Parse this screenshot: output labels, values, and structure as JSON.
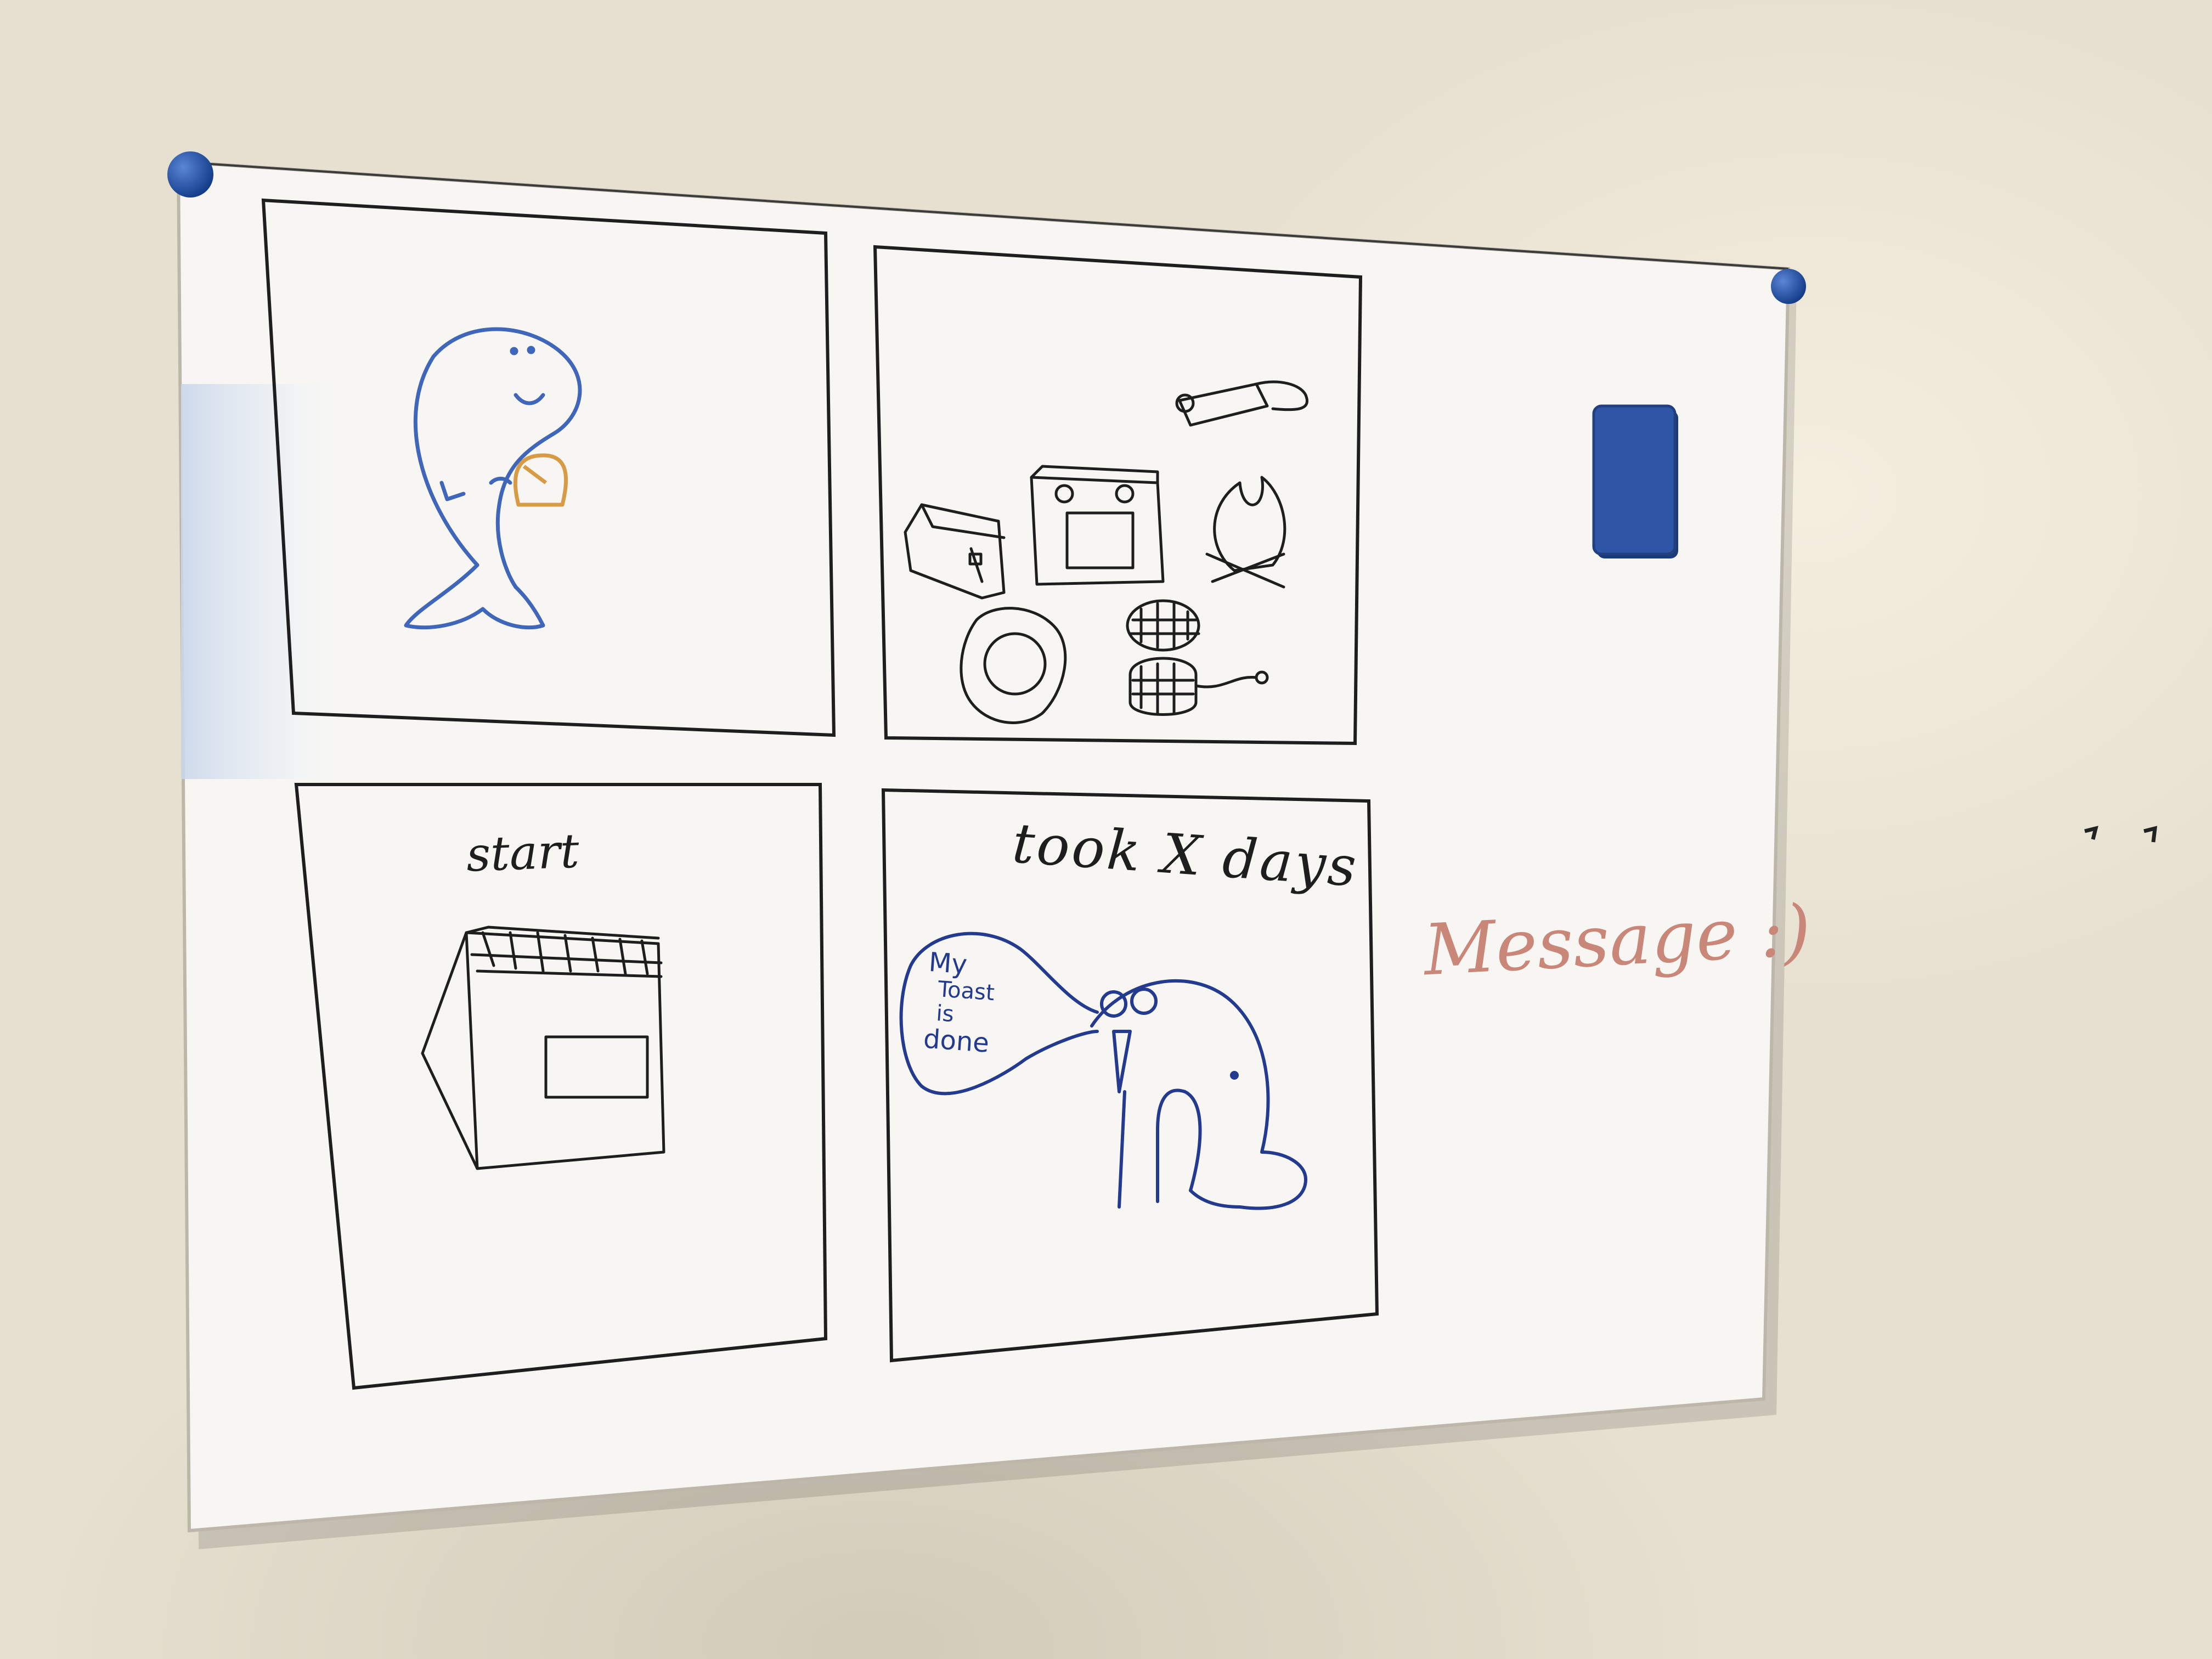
{
  "scene": {
    "wall_color": "#e6e0d0",
    "board_color": "#f7f6f2",
    "magnet_color": "#1f4fa8",
    "eraser_color": "#2e55a6",
    "blue_marker": "#3f66b8",
    "black_marker": "#1e1e1e",
    "red_marker": "#c9877a",
    "orange_marker": "#d79a45"
  },
  "panel_bottom_left": {
    "caption": "start"
  },
  "panel_bottom_right": {
    "caption": "took X days",
    "speech_lines": [
      "My",
      "Toast",
      "is",
      "done"
    ]
  },
  "board_note": {
    "text": "Message :)"
  }
}
